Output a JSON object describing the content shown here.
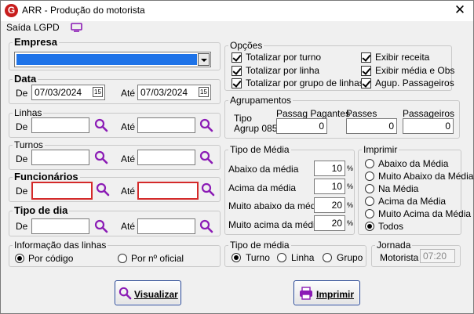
{
  "window": {
    "title": "ARR - Produção do motorista",
    "close": "✕"
  },
  "menu": {
    "saida": "Saída",
    "lgpd": "LGPD"
  },
  "empresa": {
    "legend": "Empresa",
    "value": ""
  },
  "data": {
    "legend": "Data",
    "de_label": "De",
    "de_value": "07/03/2024",
    "ate_label": "Até",
    "ate_value": "07/03/2024"
  },
  "linhas": {
    "legend": "Linhas",
    "de_label": "De",
    "ate_label": "Até",
    "de_value": "",
    "ate_value": ""
  },
  "turnos": {
    "legend": "Turnos",
    "de_label": "De",
    "ate_label": "Até",
    "de_value": "",
    "ate_value": ""
  },
  "funcionarios": {
    "legend": "Funcionários",
    "de_label": "De",
    "ate_label": "Até",
    "de_value": "",
    "ate_value": ""
  },
  "tipo_dia": {
    "legend": "Tipo de dia",
    "de_label": "De",
    "ate_label": "Até",
    "de_value": "",
    "ate_value": ""
  },
  "info_linhas": {
    "legend": "Informação das linhas",
    "opt1": "Por código",
    "opt2": "Por nº oficial",
    "selected": "Por código"
  },
  "opcoes": {
    "legend": "Opções",
    "items": [
      {
        "label": "Totalizar por turno",
        "checked": true
      },
      {
        "label": "Totalizar por linha",
        "checked": true
      },
      {
        "label": "Totalizar por grupo de linhas",
        "checked": true
      },
      {
        "label": "Exibir receita",
        "checked": true
      },
      {
        "label": "Exibir média e Obs",
        "checked": true
      },
      {
        "label": "Agup. Passageiros",
        "checked": true
      }
    ]
  },
  "agrupamentos": {
    "legend": "Agrupamentos",
    "tipo_label": "Tipo",
    "agrup_label": "Agrup 085",
    "pagantes_label": "Passag Pagantes",
    "pagantes_value": "0",
    "passes_label": "Passes",
    "passes_value": "0",
    "passageiros_label": "Passageiros",
    "passageiros_value": "0"
  },
  "tipo_media": {
    "legend": "Tipo de Média",
    "rows": [
      {
        "label": "Abaixo da média",
        "value": "10"
      },
      {
        "label": "Acima da média",
        "value": "10"
      },
      {
        "label": "Muito abaixo da média",
        "value": "20"
      },
      {
        "label": "Muito acima da média",
        "value": "20"
      }
    ],
    "unit": "%"
  },
  "imprimir_grp": {
    "legend": "Imprimir",
    "options": [
      "Abaixo da Média",
      "Muito Abaixo da Média",
      "Na Média",
      "Acima da Média",
      "Muito Acima da Média",
      "Todos"
    ],
    "selected": "Todos"
  },
  "tipo_media2": {
    "legend": "Tipo de média",
    "options": [
      "Turno",
      "Linha",
      "Grupo"
    ],
    "selected": "Turno"
  },
  "jornada": {
    "legend": "Jornada",
    "motorista_label": "Motorista",
    "motorista_value": "07:20"
  },
  "buttons": {
    "visualizar": "Visualizar",
    "imprimir": "Imprimir"
  },
  "colors": {
    "accent": "#8b1bb5",
    "red_border": "#d42a2a",
    "button_border": "#1f3f8f",
    "selection": "#1e73e8"
  }
}
